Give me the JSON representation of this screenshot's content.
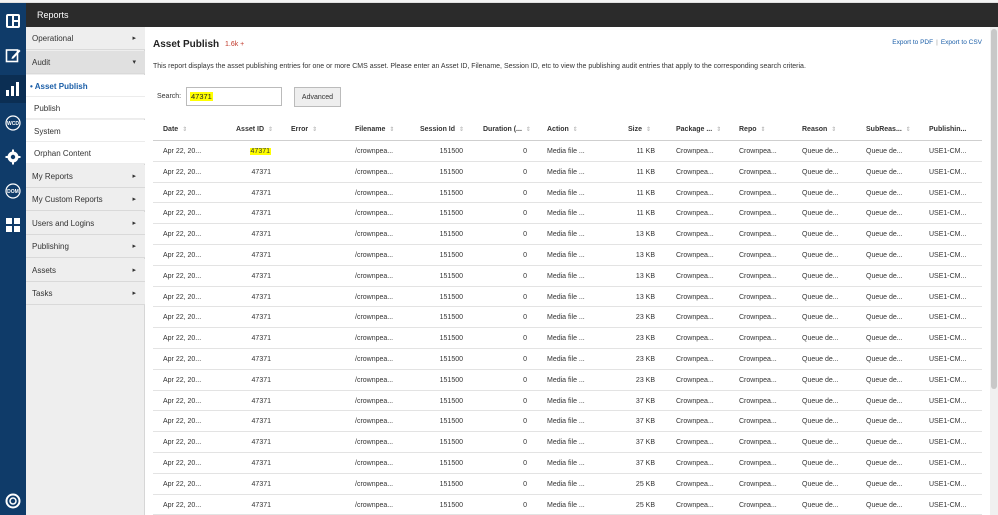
{
  "header": {
    "title": "Reports"
  },
  "rail": [
    {
      "name": "dashboard-icon"
    },
    {
      "name": "edit-icon"
    },
    {
      "name": "reports-icon"
    },
    {
      "name": "wcd-icon",
      "label": "WCD"
    },
    {
      "name": "gear-icon"
    },
    {
      "name": "dom-icon",
      "label": "DOM"
    },
    {
      "name": "tools-icon"
    },
    {
      "name": "help-icon"
    }
  ],
  "sidebar": {
    "items": [
      {
        "label": "Operational",
        "chevron": "▸"
      },
      {
        "label": "Audit",
        "chevron": "▾"
      },
      {
        "label": "• Asset Publish"
      },
      {
        "label": "Publish"
      },
      {
        "label": "System"
      },
      {
        "label": "Orphan Content"
      },
      {
        "label": "My Reports",
        "chevron": "▸"
      },
      {
        "label": "My Custom Reports",
        "chevron": "▸"
      },
      {
        "label": "Users and Logins",
        "chevron": "▸"
      },
      {
        "label": "Publishing",
        "chevron": "▸"
      },
      {
        "label": "Assets",
        "chevron": "▸"
      },
      {
        "label": "Tasks",
        "chevron": "▸"
      }
    ]
  },
  "main": {
    "title": "Asset Publish",
    "count": "1.6k +",
    "export_pdf": "Export to PDF",
    "export_sep": "|",
    "export_csv": "Export to CSV",
    "description": "This report displays the asset publishing entries for one or more CMS asset. Please enter an Asset ID, Filename, Session ID, etc to view the publishing audit entries that apply to the corresponding search criteria.",
    "search_label": "Search:",
    "search_value": "47371",
    "advanced_label": "Advanced"
  },
  "table": {
    "columns": [
      "Date",
      "Asset ID",
      "Error",
      "Filename",
      "Session Id",
      "Duration (...",
      "Action",
      "Size",
      "Package ...",
      "Repo",
      "Reason",
      "SubReas...",
      "Publishin..."
    ],
    "sort_glyph": "⇕",
    "rows": [
      [
        "Apr 22, 20...",
        "47371",
        "",
        "/crownpea...",
        "151500",
        "0",
        "Media file ...",
        "11 KB",
        "Crownpea...",
        "Crownpea...",
        "Queue de...",
        "Queue de...",
        "USE1-CM..."
      ],
      [
        "Apr 22, 20...",
        "47371",
        "",
        "/crownpea...",
        "151500",
        "0",
        "Media file ...",
        "11 KB",
        "Crownpea...",
        "Crownpea...",
        "Queue de...",
        "Queue de...",
        "USE1-CM..."
      ],
      [
        "Apr 22, 20...",
        "47371",
        "",
        "/crownpea...",
        "151500",
        "0",
        "Media file ...",
        "11 KB",
        "Crownpea...",
        "Crownpea...",
        "Queue de...",
        "Queue de...",
        "USE1-CM..."
      ],
      [
        "Apr 22, 20...",
        "47371",
        "",
        "/crownpea...",
        "151500",
        "0",
        "Media file ...",
        "11 KB",
        "Crownpea...",
        "Crownpea...",
        "Queue de...",
        "Queue de...",
        "USE1-CM..."
      ],
      [
        "Apr 22, 20...",
        "47371",
        "",
        "/crownpea...",
        "151500",
        "0",
        "Media file ...",
        "13 KB",
        "Crownpea...",
        "Crownpea...",
        "Queue de...",
        "Queue de...",
        "USE1-CM..."
      ],
      [
        "Apr 22, 20...",
        "47371",
        "",
        "/crownpea...",
        "151500",
        "0",
        "Media file ...",
        "13 KB",
        "Crownpea...",
        "Crownpea...",
        "Queue de...",
        "Queue de...",
        "USE1-CM..."
      ],
      [
        "Apr 22, 20...",
        "47371",
        "",
        "/crownpea...",
        "151500",
        "0",
        "Media file ...",
        "13 KB",
        "Crownpea...",
        "Crownpea...",
        "Queue de...",
        "Queue de...",
        "USE1-CM..."
      ],
      [
        "Apr 22, 20...",
        "47371",
        "",
        "/crownpea...",
        "151500",
        "0",
        "Media file ...",
        "13 KB",
        "Crownpea...",
        "Crownpea...",
        "Queue de...",
        "Queue de...",
        "USE1-CM..."
      ],
      [
        "Apr 22, 20...",
        "47371",
        "",
        "/crownpea...",
        "151500",
        "0",
        "Media file ...",
        "23 KB",
        "Crownpea...",
        "Crownpea...",
        "Queue de...",
        "Queue de...",
        "USE1-CM..."
      ],
      [
        "Apr 22, 20...",
        "47371",
        "",
        "/crownpea...",
        "151500",
        "0",
        "Media file ...",
        "23 KB",
        "Crownpea...",
        "Crownpea...",
        "Queue de...",
        "Queue de...",
        "USE1-CM..."
      ],
      [
        "Apr 22, 20...",
        "47371",
        "",
        "/crownpea...",
        "151500",
        "0",
        "Media file ...",
        "23 KB",
        "Crownpea...",
        "Crownpea...",
        "Queue de...",
        "Queue de...",
        "USE1-CM..."
      ],
      [
        "Apr 22, 20...",
        "47371",
        "",
        "/crownpea...",
        "151500",
        "0",
        "Media file ...",
        "23 KB",
        "Crownpea...",
        "Crownpea...",
        "Queue de...",
        "Queue de...",
        "USE1-CM..."
      ],
      [
        "Apr 22, 20...",
        "47371",
        "",
        "/crownpea...",
        "151500",
        "0",
        "Media file ...",
        "37 KB",
        "Crownpea...",
        "Crownpea...",
        "Queue de...",
        "Queue de...",
        "USE1-CM..."
      ],
      [
        "Apr 22, 20...",
        "47371",
        "",
        "/crownpea...",
        "151500",
        "0",
        "Media file ...",
        "37 KB",
        "Crownpea...",
        "Crownpea...",
        "Queue de...",
        "Queue de...",
        "USE1-CM..."
      ],
      [
        "Apr 22, 20...",
        "47371",
        "",
        "/crownpea...",
        "151500",
        "0",
        "Media file ...",
        "37 KB",
        "Crownpea...",
        "Crownpea...",
        "Queue de...",
        "Queue de...",
        "USE1-CM..."
      ],
      [
        "Apr 22, 20...",
        "47371",
        "",
        "/crownpea...",
        "151500",
        "0",
        "Media file ...",
        "37 KB",
        "Crownpea...",
        "Crownpea...",
        "Queue de...",
        "Queue de...",
        "USE1-CM..."
      ],
      [
        "Apr 22, 20...",
        "47371",
        "",
        "/crownpea...",
        "151500",
        "0",
        "Media file ...",
        "25 KB",
        "Crownpea...",
        "Crownpea...",
        "Queue de...",
        "Queue de...",
        "USE1-CM..."
      ],
      [
        "Apr 22, 20...",
        "47371",
        "",
        "/crownpea...",
        "151500",
        "0",
        "Media file ...",
        "25 KB",
        "Crownpea...",
        "Crownpea...",
        "Queue de...",
        "Queue de...",
        "USE1-CM..."
      ]
    ]
  },
  "colors": {
    "rail": "#0f3b69",
    "header": "#2b2b2b",
    "link": "#1a5ea8",
    "highlight": "#ffff00",
    "count": "#c0392b"
  }
}
